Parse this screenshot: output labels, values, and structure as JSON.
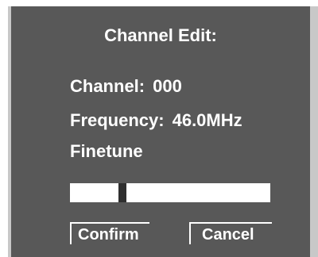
{
  "dialog": {
    "title": "Channel Edit:",
    "channel_label": "Channel:",
    "channel_value": "000",
    "frequency_label": "Frequency:",
    "frequency_value": "46.0MHz",
    "finetune_label": "Finetune",
    "finetune_level": 0.25
  },
  "buttons": {
    "confirm_label": "Confirm",
    "cancel_label": "Cancel"
  },
  "colors": {
    "panel_background": "#585858",
    "text": "#ffffff",
    "slider_thumb": "#2f2f2f"
  }
}
